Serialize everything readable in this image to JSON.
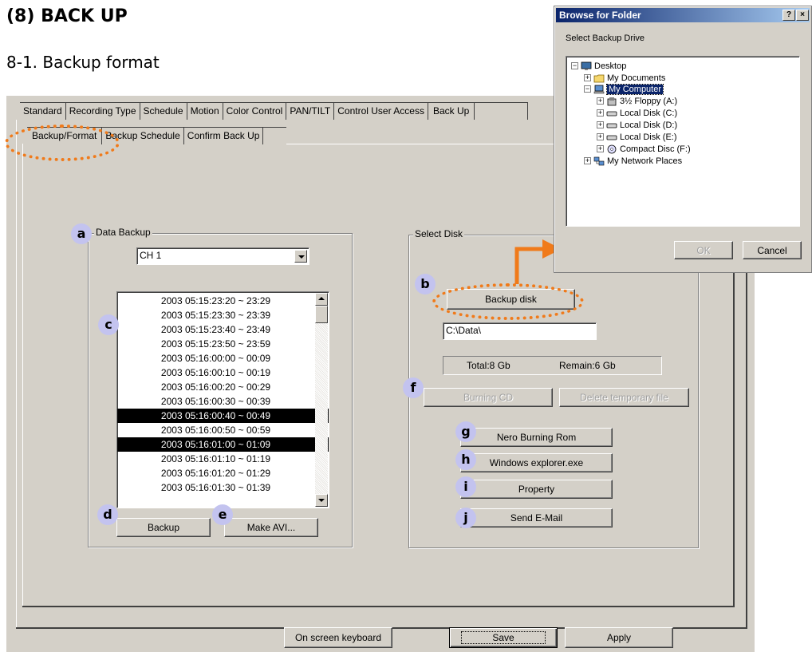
{
  "doc": {
    "title": "(8)  BACK UP",
    "subtitle": "8-1. Backup format"
  },
  "main_tabs": [
    "Standard",
    "Recording Type",
    "Schedule",
    "Motion",
    "Color Control",
    "PAN/TILT",
    "Control User Access",
    "Back Up"
  ],
  "sub_tabs": [
    "Backup/Format",
    "Backup Schedule",
    "Confirm Back Up"
  ],
  "data_backup": {
    "legend": "Data Backup",
    "channel": "CH 1",
    "items": [
      "2003 05:15:23:20 ~ 23:29",
      "2003 05:15:23:30 ~ 23:39",
      "2003 05:15:23:40 ~ 23:49",
      "2003 05:15:23:50 ~ 23:59",
      "2003 05:16:00:00 ~ 00:09",
      "2003 05:16:00:10 ~ 00:19",
      "2003 05:16:00:20 ~ 00:29",
      "2003 05:16:00:30 ~ 00:39",
      "2003 05:16:00:40 ~ 00:49",
      "2003 05:16:00:50 ~ 00:59",
      "2003 05:16:01:00 ~ 01:09",
      "2003 05:16:01:10 ~ 01:19",
      "2003 05:16:01:20 ~ 01:29",
      "2003 05:16:01:30 ~ 01:39"
    ],
    "selected_indices": [
      8,
      10
    ],
    "backup_label": "Backup",
    "make_avi_label": "Make AVI..."
  },
  "select_disk": {
    "legend": "Select Disk",
    "backup_disk_label": "Backup disk",
    "path": "C:\\Data\\",
    "total": "Total:8 Gb",
    "remain": "Remain:6 Gb",
    "burning_cd_label": "Burning CD",
    "delete_temp_label": "Delete temporary file",
    "nero_label": "Nero Burning Rom",
    "explorer_label": "Windows explorer.exe",
    "property_label": "Property",
    "email_label": "Send E-Mail"
  },
  "bottom": {
    "keyboard_label": "On screen keyboard",
    "save_label": "Save",
    "apply_label": "Apply"
  },
  "badges": {
    "a": "a",
    "b": "b",
    "c": "c",
    "d": "d",
    "e": "e",
    "f": "f",
    "g": "g",
    "h": "h",
    "i": "i",
    "j": "j"
  },
  "dialog": {
    "title": "Browse for Folder",
    "help": "?",
    "close": "×",
    "instruction": "Select Backup Drive",
    "tree": {
      "desktop": "Desktop",
      "my_documents": "My Documents",
      "my_computer": "My Computer",
      "floppy": "3½ Floppy (A:)",
      "disk_c": "Local Disk (C:)",
      "disk_d": "Local Disk (D:)",
      "disk_e": "Local Disk (E:)",
      "cd": "Compact Disc (F:)",
      "network": "My Network Places"
    },
    "ok_label": "OK",
    "cancel_label": "Cancel"
  },
  "colors": {
    "highlight": "#f07a1a",
    "badge": "#c3c3ef",
    "panel": "#d4d0c8",
    "titlebar": "#0a246a"
  }
}
